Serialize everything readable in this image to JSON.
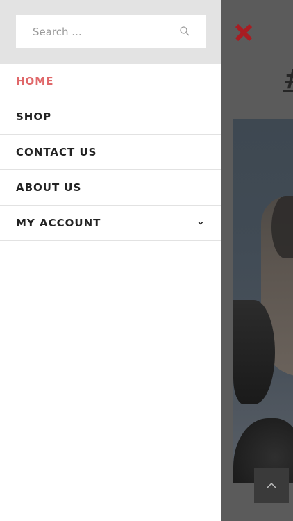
{
  "search": {
    "placeholder": "Search ..."
  },
  "menu": {
    "items": [
      {
        "label": "HOME",
        "active": true
      },
      {
        "label": "SHOP"
      },
      {
        "label": "CONTACT US"
      },
      {
        "label": "ABOUT US"
      },
      {
        "label": "MY ACCOUNT",
        "has_submenu": true
      }
    ]
  },
  "background": {
    "title": "#"
  },
  "colors": {
    "accent": "#e0686a",
    "close": "#a81c22",
    "overlay": "#5b5b5b",
    "search_bg": "#e3e3e3"
  }
}
